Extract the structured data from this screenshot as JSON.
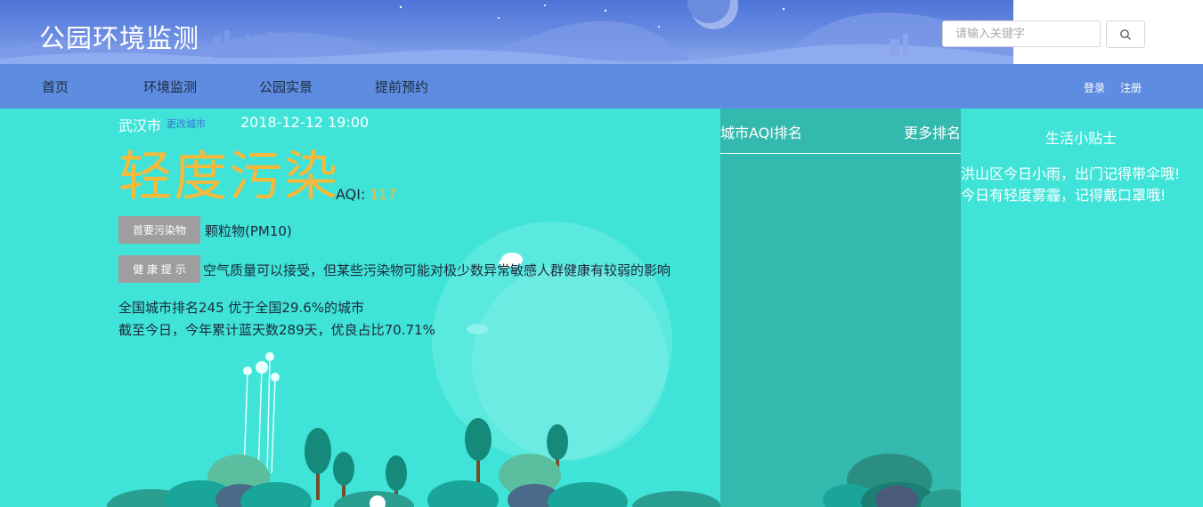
{
  "header": {
    "site_title": "公园环境监测",
    "search_placeholder": "请输入关键字",
    "search_icon": "search-icon"
  },
  "nav": {
    "items": [
      "首页",
      "环境监测",
      "公园实景",
      "提前预约"
    ],
    "login": "登录",
    "register": "注册"
  },
  "air": {
    "city": "武汉市",
    "change_city": "更改城市",
    "datetime": "2018-12-12 19:00",
    "level": "轻度污染",
    "aqi_label": "AQI:",
    "aqi_value": "117",
    "primary_pollutant_label": "首要污染物",
    "primary_pollutant": "颗粒物(PM10)",
    "health_tip_label": "健 康 提 示",
    "health_tip": "空气质量可以接受，但某些污染物可能对极少数异常敏感人群健康有较弱的影响",
    "national_rank": "全国城市排名245 优于全国29.6%的城市",
    "blue_sky_days": "截至今日，今年累计蓝天数289天，优良占比70.71%"
  },
  "ranking": {
    "title": "城市AQI排名",
    "more": "更多排名"
  },
  "tips": {
    "title": "生活小贴士",
    "lines": [
      "洪山区今日小雨，出门记得带伞哦!",
      "今日有轻度雾霾，记得戴口罩哦!"
    ]
  },
  "colors": {
    "header_blue": "#5e8ce0",
    "main_bg": "#3fe3d8",
    "panel_bg": "#33b9ae",
    "level_color": "#f6b93b",
    "tag_gray": "#9e9e9e",
    "link_blue": "#3a72d6"
  }
}
